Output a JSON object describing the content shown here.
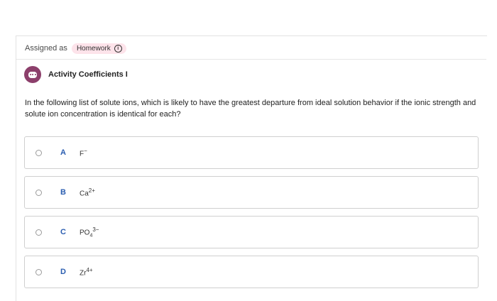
{
  "assignment": {
    "label": "Assigned as",
    "badge": "Homework",
    "badge_icon": "info-icon"
  },
  "activity": {
    "icon": "chat-bubble-icon",
    "title": "Activity Coefficients I",
    "accent_color": "#8c3f6b"
  },
  "question": {
    "text": "In the following list of solute ions, which is likely to have the greatest departure from ideal solution behavior if the ionic strength and solute ion concentration is identical for each?"
  },
  "options": [
    {
      "letter": "A",
      "base": "F",
      "sub": "",
      "sup": "−"
    },
    {
      "letter": "B",
      "base": "Ca",
      "sub": "",
      "sup": "2+"
    },
    {
      "letter": "C",
      "base": "PO",
      "sub": "4",
      "sup": "3−"
    },
    {
      "letter": "D",
      "base": "Zr",
      "sub": "",
      "sup": "4+"
    }
  ]
}
